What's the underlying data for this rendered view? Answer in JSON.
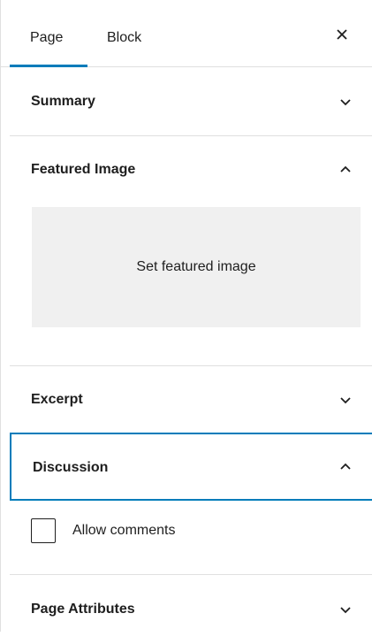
{
  "tabs": {
    "page_label": "Page",
    "block_label": "Block"
  },
  "close_icon": "close-x-icon",
  "panels": {
    "summary": {
      "title": "Summary",
      "expanded": false
    },
    "featured_image": {
      "title": "Featured Image",
      "expanded": true,
      "button_label": "Set featured image"
    },
    "excerpt": {
      "title": "Excerpt",
      "expanded": false
    },
    "discussion": {
      "title": "Discussion",
      "expanded": true,
      "checkbox_label": "Allow comments",
      "checked": false
    },
    "page_attributes": {
      "title": "Page Attributes",
      "expanded": false
    }
  },
  "colors": {
    "accent": "#007cba",
    "placeholder_bg": "#f0f0f0",
    "divider": "#e0e0e0",
    "text": "#1e1e1e"
  }
}
